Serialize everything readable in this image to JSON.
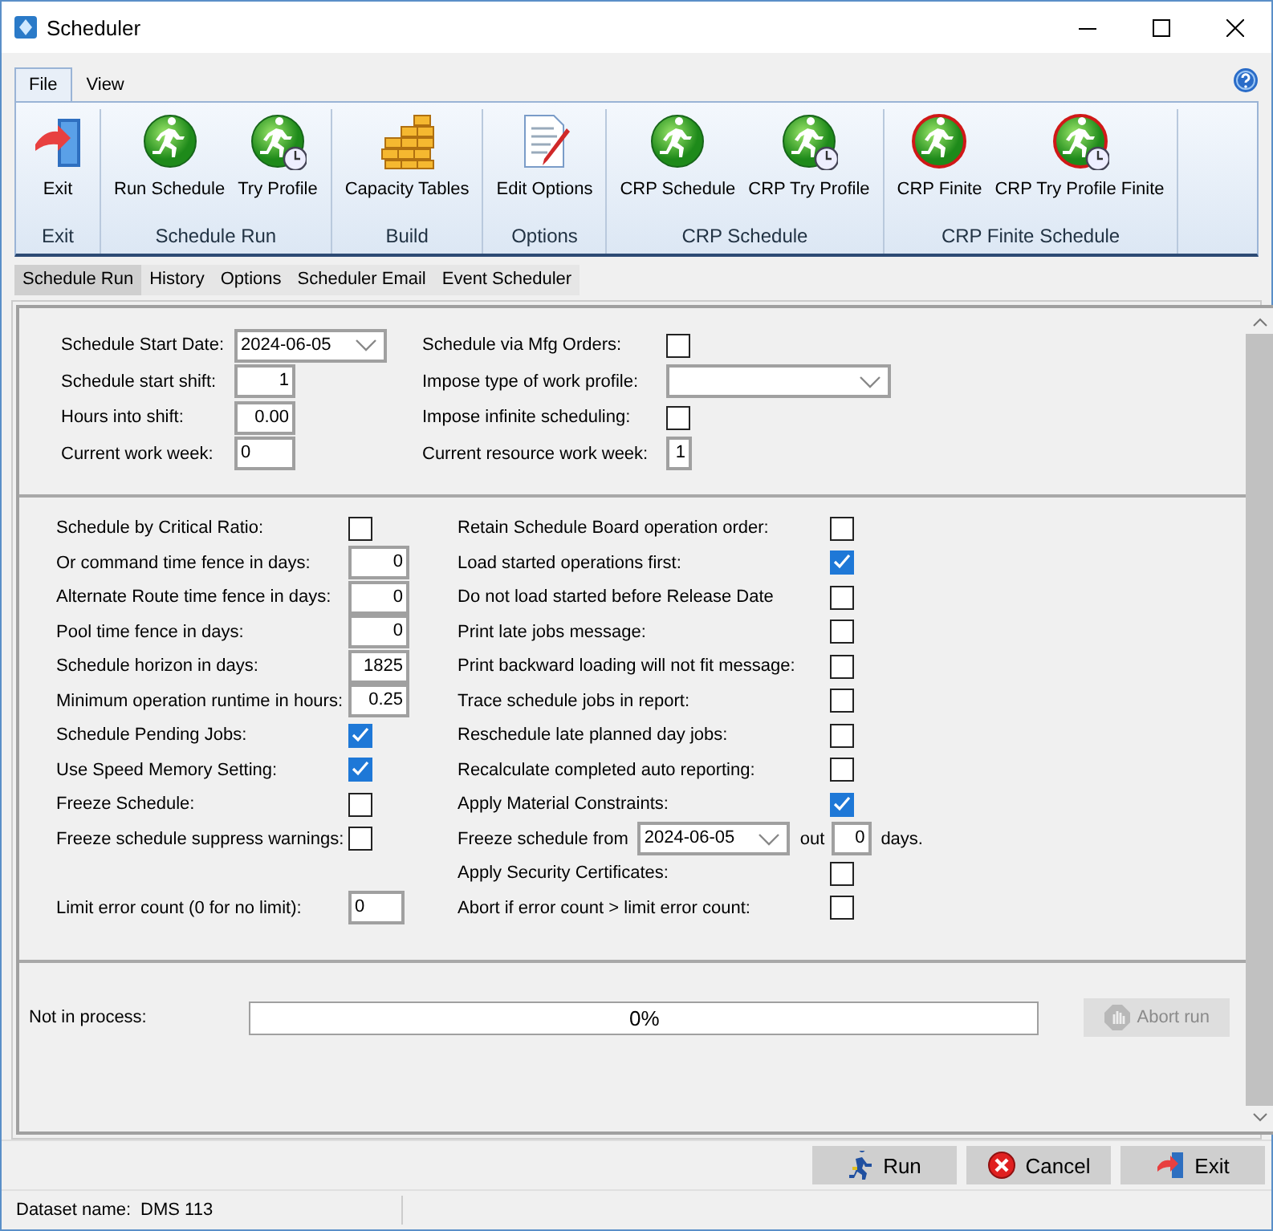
{
  "window": {
    "title": "Scheduler"
  },
  "ribbon_tabs": [
    {
      "label": "File",
      "selected": true
    },
    {
      "label": "View",
      "selected": false
    }
  ],
  "ribbon_groups": [
    {
      "label": "Exit",
      "buttons": [
        {
          "label": "Exit",
          "kind": "exit"
        }
      ]
    },
    {
      "label": "Schedule Run",
      "buttons": [
        {
          "label": "Run Schedule",
          "kind": "run"
        },
        {
          "label": "Try Profile",
          "kind": "try"
        }
      ]
    },
    {
      "label": "Build",
      "buttons": [
        {
          "label": "Capacity Tables",
          "kind": "build"
        }
      ]
    },
    {
      "label": "Options",
      "buttons": [
        {
          "label": "Edit Options",
          "kind": "edit"
        }
      ]
    },
    {
      "label": "CRP Schedule",
      "buttons": [
        {
          "label": "CRP Schedule",
          "kind": "run"
        },
        {
          "label": "CRP Try Profile",
          "kind": "try"
        }
      ]
    },
    {
      "label": "CRP Finite Schedule",
      "buttons": [
        {
          "label": "CRP Finite",
          "kind": "finite"
        },
        {
          "label": "CRP Try Profile Finite",
          "kind": "finite-try"
        }
      ]
    }
  ],
  "tabs": [
    {
      "label": "Schedule Run",
      "selected": true
    },
    {
      "label": "History",
      "selected": false
    },
    {
      "label": "Options",
      "selected": false
    },
    {
      "label": "Scheduler Email",
      "selected": false
    },
    {
      "label": "Event Scheduler",
      "selected": false
    }
  ],
  "start_settings": {
    "left": [
      {
        "kind": "date",
        "label": "Schedule Start Date:",
        "value": "2024-06-05"
      },
      {
        "kind": "number",
        "label": "Schedule start shift:",
        "value": "1"
      },
      {
        "kind": "number",
        "label": "Hours into shift:",
        "value": "0.00"
      },
      {
        "kind": "text",
        "label": "Current work week:",
        "value": "0"
      }
    ],
    "right": [
      {
        "kind": "checkbox",
        "label": "Schedule via Mfg Orders:",
        "checked": false
      },
      {
        "kind": "select",
        "label": "Impose type of work profile:"
      },
      {
        "kind": "checkbox",
        "label": "Impose infinite scheduling:",
        "checked": false
      },
      {
        "kind": "digit",
        "label": "Current resource work week:",
        "value": "1"
      }
    ]
  },
  "options": {
    "rows": [
      {
        "left": {
          "kind": "checkbox",
          "label": "Schedule by Critical Ratio:",
          "checked": false
        },
        "right": {
          "kind": "checkbox",
          "label": "Retain Schedule Board operation order:",
          "checked": false
        }
      },
      {
        "left": {
          "kind": "number",
          "label": "Or command time fence in days:",
          "value": "0"
        },
        "right": {
          "kind": "checkbox",
          "label": "Load started operations first:",
          "checked": true
        }
      },
      {
        "left": {
          "kind": "number",
          "label": "Alternate Route time fence in days:",
          "value": "0"
        },
        "right": {
          "kind": "checkbox",
          "label": "Do not load started before Release Date",
          "checked": false
        }
      },
      {
        "left": {
          "kind": "number",
          "label": "Pool time fence in days:",
          "value": "0"
        },
        "right": {
          "kind": "checkbox",
          "label": "Print late jobs message:",
          "checked": false
        }
      },
      {
        "left": {
          "kind": "number",
          "label": "Schedule horizon in days:",
          "value": "1825"
        },
        "right": {
          "kind": "checkbox",
          "label": "Print backward loading will not fit message:",
          "checked": false
        }
      },
      {
        "left": {
          "kind": "number",
          "label": "Minimum operation runtime in hours:",
          "value": "0.25"
        },
        "right": {
          "kind": "checkbox",
          "label": "Trace schedule jobs in report:",
          "checked": false
        }
      },
      {
        "left": {
          "kind": "checkbox",
          "label": "Schedule Pending Jobs:",
          "checked": true
        },
        "right": {
          "kind": "checkbox",
          "label": "Reschedule late planned day jobs:",
          "checked": false
        }
      },
      {
        "left": {
          "kind": "checkbox",
          "label": "Use Speed Memory Setting:",
          "checked": true
        },
        "right": {
          "kind": "checkbox",
          "label": "Recalculate completed auto reporting:",
          "checked": false
        }
      },
      {
        "left": {
          "kind": "checkbox",
          "label": "Freeze Schedule:",
          "checked": false
        },
        "right": {
          "kind": "checkbox",
          "label": "Apply Material Constraints:",
          "checked": true
        }
      },
      {
        "left": {
          "kind": "checkbox",
          "label": "Freeze schedule suppress warnings:",
          "checked": false
        },
        "right": {
          "kind": "freeze",
          "label": "Freeze schedule from",
          "date": "2024-06-05",
          "out_label": "out",
          "days": "0",
          "days_label": "days."
        }
      },
      {
        "right": {
          "kind": "checkbox",
          "label": "Apply Security Certificates:",
          "checked": false
        }
      },
      {
        "left": {
          "kind": "text",
          "label": "Limit error count (0 for no limit):",
          "value": "0"
        },
        "right": {
          "kind": "checkbox",
          "label": "Abort if error count > limit error count:",
          "checked": false
        }
      }
    ]
  },
  "progress": {
    "label": "Not in process:",
    "level": 0,
    "reading": "0%"
  },
  "abort_button": {
    "label": "Abort run",
    "disabled": true
  },
  "buttons": [
    {
      "label": "Run",
      "kind": "run"
    },
    {
      "label": "Cancel",
      "kind": "cancel"
    },
    {
      "label": "Exit",
      "kind": "exit"
    }
  ],
  "status_bar": {
    "label": "Dataset name:",
    "value": "DMS 113"
  }
}
